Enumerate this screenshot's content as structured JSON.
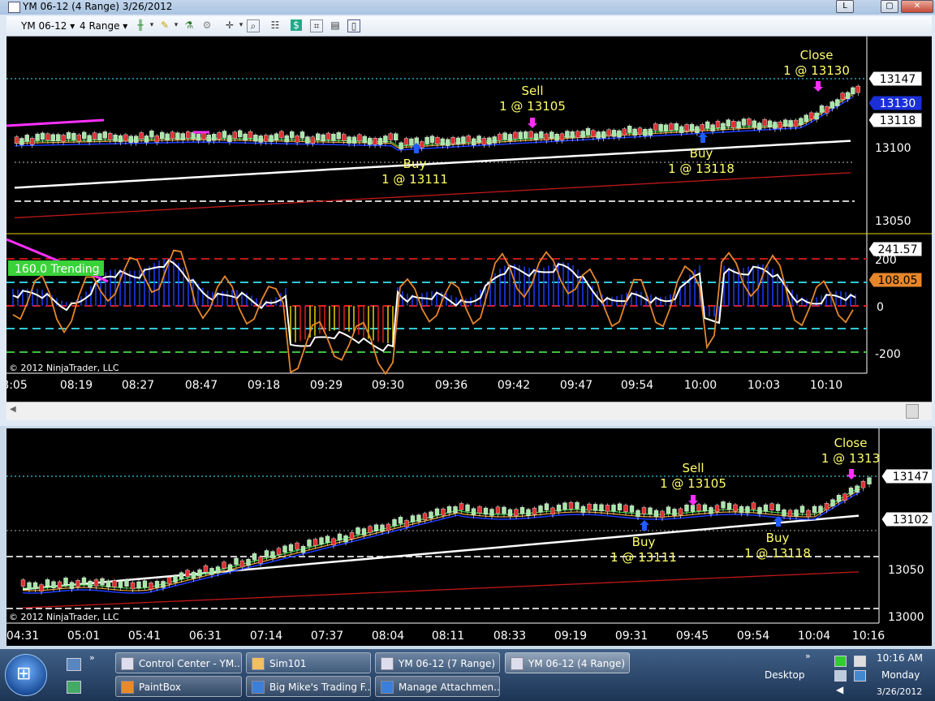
{
  "window": {
    "title": "YM 06-12 (4 Range)  3/26/2012",
    "controls": [
      "L",
      "▢",
      "✕"
    ]
  },
  "toolbar": {
    "instrument": "YM 06-12",
    "period": "4 Range"
  },
  "chart1": {
    "price_labels": [
      "13147",
      "13130",
      "13118",
      "13100",
      "13050"
    ],
    "trades": [
      {
        "side": "Sell",
        "fill": "1 @ 13105"
      },
      {
        "side": "Close",
        "fill": "1 @ 13130"
      },
      {
        "side": "Buy",
        "fill": "1 @ 13111"
      },
      {
        "side": "Buy",
        "fill": "1 @ 13118"
      }
    ],
    "indicator_banner": "160.0 Trending",
    "indicator_labels": [
      "241.57",
      "108.05",
      "200",
      "0",
      "-200"
    ],
    "copyright": "© 2012 NinjaTrader, LLC",
    "time_labels": [
      "8:05",
      "08:19",
      "08:27",
      "08:47",
      "09:18",
      "09:29",
      "09:30",
      "09:36",
      "09:42",
      "09:47",
      "09:54",
      "10:00",
      "10:03",
      "10:10"
    ]
  },
  "chart2": {
    "price_labels": [
      "13147",
      "13102",
      "13050",
      "13000"
    ],
    "trades": [
      {
        "side": "Sell",
        "fill": "1 @ 13105"
      },
      {
        "side": "Close",
        "fill": "1 @ 1313"
      },
      {
        "side": "Buy",
        "fill": "1 @ 13111"
      },
      {
        "side": "Buy",
        "fill": "1 @ 13118"
      }
    ],
    "copyright": "© 2012 NinjaTrader, LLC",
    "time_labels": [
      "04:31",
      "05:01",
      "05:41",
      "06:31",
      "07:14",
      "07:37",
      "08:04",
      "08:11",
      "08:33",
      "09:19",
      "09:31",
      "09:45",
      "09:54",
      "10:04",
      "10:16"
    ]
  },
  "colors": {
    "up": "#a8e6a8",
    "down": "#e03030",
    "sell_marker": "#ff30ff",
    "buy_marker": "#1f5cff",
    "trade_text": "#ffff66",
    "price_text": "#ffffff"
  },
  "taskbar": {
    "tasks": [
      "Control Center - YM...",
      "Sim101",
      "YM 06-12 (7 Range) ...",
      "YM 06-12 (4 Range) ...",
      "PaintBox",
      "Big Mike's Trading F...",
      "Manage Attachmen..."
    ],
    "desktop": "Desktop",
    "clock": {
      "time": "10:16 AM",
      "day": "Monday",
      "date": "3/26/2012"
    }
  }
}
